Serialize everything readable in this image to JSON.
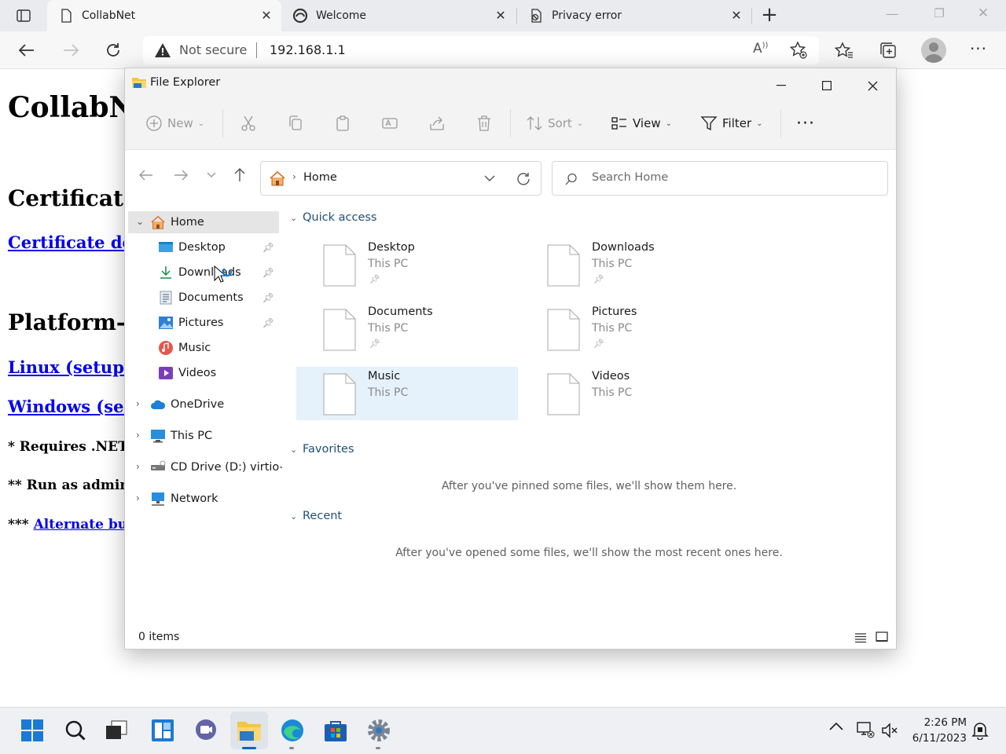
{
  "browser": {
    "tabs": [
      {
        "title": "CollabNet",
        "active": true
      },
      {
        "title": "Welcome",
        "active": false
      },
      {
        "title": "Privacy error",
        "active": false
      }
    ],
    "address": {
      "security_label": "Not secure",
      "url": "192.168.1.1"
    }
  },
  "page": {
    "title": "CollabNe",
    "h_certificate": "Certificate",
    "link_certificate": "Certificate dow",
    "h_platform": "Platform-sp",
    "link_linux": "Linux (setupce",
    "link_windows": "Windows (setu",
    "note1": "* Requires .NET",
    "note2": "** Run as admini",
    "note3_prefix": "***",
    "note3_link": "Alternate bui"
  },
  "explorer": {
    "title": "File Explorer",
    "commands": {
      "new": "New",
      "sort": "Sort",
      "view": "View",
      "filter": "Filter"
    },
    "breadcrumb": "Home",
    "search_placeholder": "Search Home",
    "nav": {
      "home": "Home",
      "pinned": [
        {
          "label": "Desktop"
        },
        {
          "label": "Downloads"
        },
        {
          "label": "Documents"
        },
        {
          "label": "Pictures"
        },
        {
          "label": "Music"
        },
        {
          "label": "Videos"
        }
      ],
      "onedrive": "OneDrive",
      "thispc": "This PC",
      "cddrive": "CD Drive (D:) virtio-w",
      "network": "Network"
    },
    "sections": {
      "quick_access": "Quick access",
      "favorites": "Favorites",
      "recent": "Recent"
    },
    "quick_access": [
      {
        "name": "Desktop",
        "location": "This PC"
      },
      {
        "name": "Downloads",
        "location": "This PC"
      },
      {
        "name": "Documents",
        "location": "This PC"
      },
      {
        "name": "Pictures",
        "location": "This PC"
      },
      {
        "name": "Music",
        "location": "This PC"
      },
      {
        "name": "Videos",
        "location": "This PC"
      }
    ],
    "favorites_empty": "After you've pinned some files, we'll show them here.",
    "recent_empty": "After you've opened some files, we'll show the most recent ones here.",
    "status": "0 items"
  },
  "taskbar": {
    "time": "2:26 PM",
    "date": "6/11/2023"
  },
  "colors": {
    "accent": "#0067c0",
    "selection": "#e5f1fb",
    "folder": "#f4c542"
  }
}
